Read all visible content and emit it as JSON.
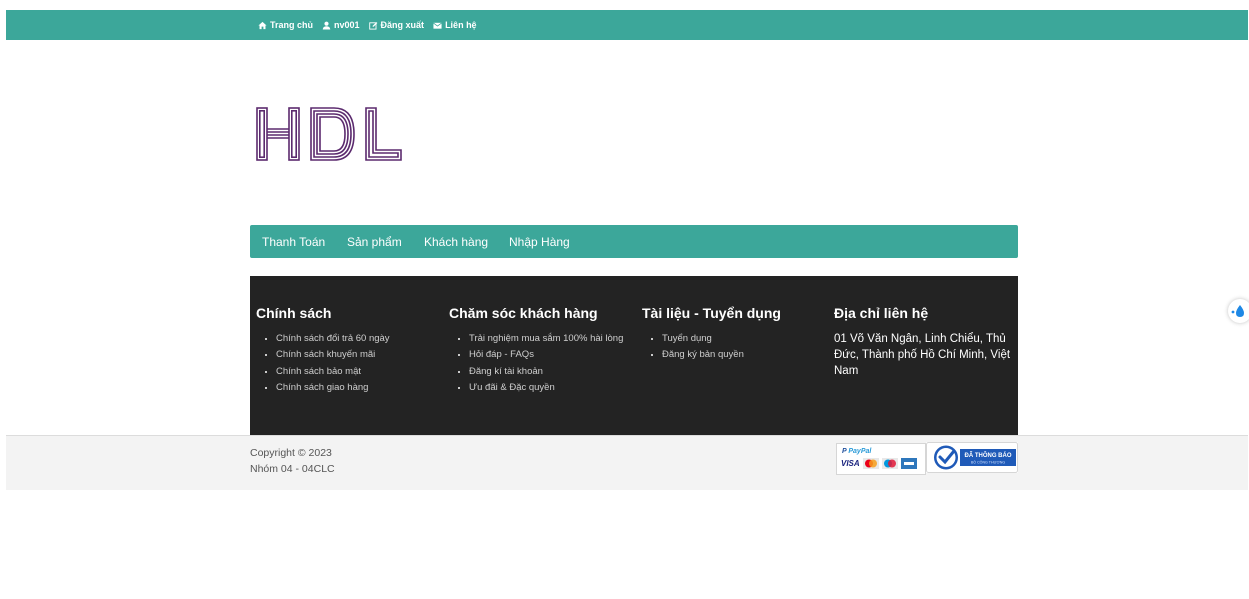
{
  "topnav": {
    "home": "Trang chủ",
    "user": "nv001",
    "logout": "Đăng xuất",
    "contact": "Liên hệ"
  },
  "logo": {
    "text": "HDL"
  },
  "menu": [
    "Thanh Toán",
    "Sản phẩm",
    "Khách hàng",
    "Nhập Hàng"
  ],
  "footer": {
    "policy": {
      "title": "Chính sách",
      "items": [
        "Chính sách đổi trả 60 ngày",
        "Chính sách khuyến mãi",
        "Chính sách bảo mật",
        "Chính sách giao hàng"
      ]
    },
    "care": {
      "title": "Chăm sóc khách hàng",
      "items": [
        "Trải nghiệm mua sắm 100% hài lòng",
        "Hỏi đáp - FAQs",
        "Đăng kí tài khoản",
        "Ưu đãi & Đặc quyền"
      ]
    },
    "docs": {
      "title": "Tài liệu - Tuyển dụng",
      "items": [
        "Tuyển dụng",
        "Đăng ký bản quyền"
      ]
    },
    "address": {
      "title": "Địa chỉ liên hệ",
      "text": "01 Võ Văn Ngân, Linh Chiểu, Thủ Đức, Thành phố Hồ Chí Minh, Việt Nam"
    }
  },
  "copyright": {
    "line1": "Copyright © 2023",
    "line2": "Nhóm 04 - 04CLC"
  },
  "payment": {
    "paypal": "PayPal",
    "visa": "VISA",
    "badge": "ĐÃ THÔNG BÁO",
    "badge_sub": "BỘ CÔNG THƯƠNG"
  },
  "colors": {
    "accent": "#3ca79a",
    "footer_dark": "#232323",
    "logo": "#5b2a6e"
  }
}
